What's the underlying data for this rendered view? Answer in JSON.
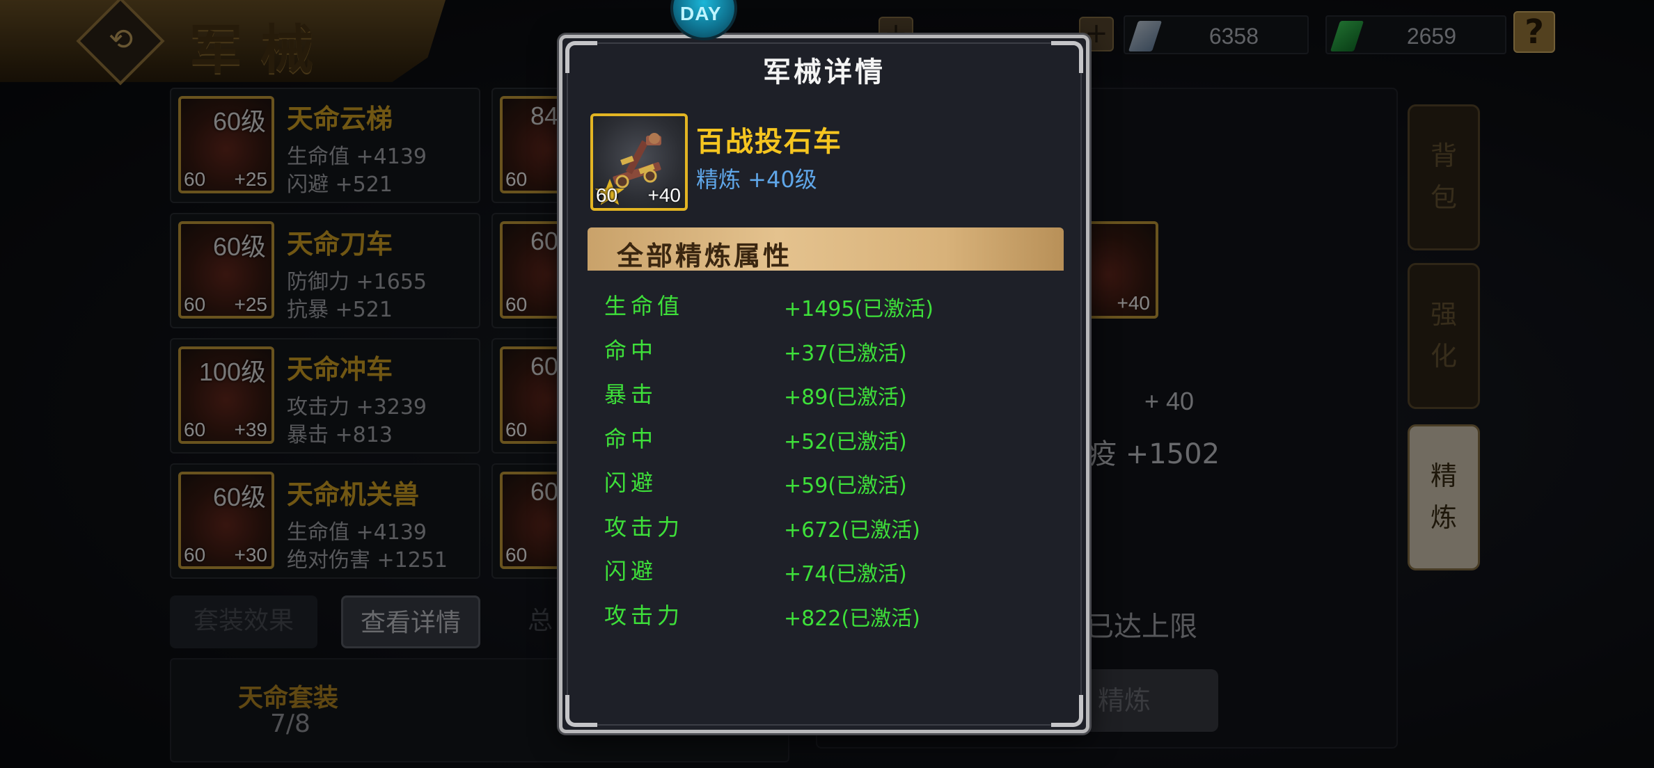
{
  "header": {
    "title": "军械",
    "resource1_value": "6358",
    "resource2_value": "2659",
    "help_label": "?",
    "back_icon": "back-arrow-icon"
  },
  "equipment_list": [
    {
      "level": "60级",
      "name": "天命云梯",
      "stat1": "生命值 +4139",
      "stat2": "闪避 +521",
      "corner_level": "60",
      "plus": "+25"
    },
    {
      "level": "60级",
      "name": "天命刀车",
      "stat1": "防御力 +1655",
      "stat2": "抗暴 +521",
      "corner_level": "60",
      "plus": "+25"
    },
    {
      "level": "100级",
      "name": "天命冲车",
      "stat1": "攻击力 +3239",
      "stat2": "暴击 +813",
      "corner_level": "60",
      "plus": "+39"
    },
    {
      "level": "60级",
      "name": "天命机关兽",
      "stat1": "生命值 +4139",
      "stat2": "绝对伤害 +1251",
      "corner_level": "60",
      "plus": "+30"
    }
  ],
  "equipment_list_col2": [
    {
      "level": "84",
      "corner_level": "60"
    },
    {
      "level": "60",
      "corner_level": "60"
    },
    {
      "level": "60",
      "corner_level": "60"
    },
    {
      "level": "60",
      "corner_level": "60"
    }
  ],
  "bottom_tabs": {
    "set_effect": "套装效果",
    "view_details": "查看详情",
    "total": "总"
  },
  "set_info": {
    "name": "天命套装",
    "progress": "7/8"
  },
  "right_panel": {
    "thumb_plus": "+40",
    "refine_plus": "+ 40",
    "stat_text": "疫 +1502",
    "limit_text": "已达上限",
    "refine_button": "精炼"
  },
  "side_tabs": [
    {
      "label_top": "背",
      "label_bottom": "包",
      "active": false
    },
    {
      "label_top": "强",
      "label_bottom": "化",
      "active": false
    },
    {
      "label_top": "精",
      "label_bottom": "炼",
      "active": true
    }
  ],
  "dialog": {
    "badge_text": "DAY",
    "title": "军械详情",
    "item": {
      "name": "百战投石车",
      "refine_level": "精炼 +40级",
      "corner_level": "60",
      "plus": "+40"
    },
    "section_title": "全部精炼属性",
    "attributes": [
      {
        "name": "生命值",
        "value": "+1495(已激活)"
      },
      {
        "name": "命中",
        "value": "+37(已激活)"
      },
      {
        "name": "暴击",
        "value": "+89(已激活)"
      },
      {
        "name": "命中",
        "value": "+52(已激活)"
      },
      {
        "name": "闪避",
        "value": "+59(已激活)"
      },
      {
        "name": "攻击力",
        "value": "+672(已激活)"
      },
      {
        "name": "闪避",
        "value": "+74(已激活)"
      },
      {
        "name": "攻击力",
        "value": "+822(已激活)"
      }
    ]
  },
  "colors": {
    "gold": "#d9a826",
    "attr_green": "#3ee03a",
    "refine_blue": "#5fa6e8",
    "item_name_yellow": "#f5c520"
  }
}
